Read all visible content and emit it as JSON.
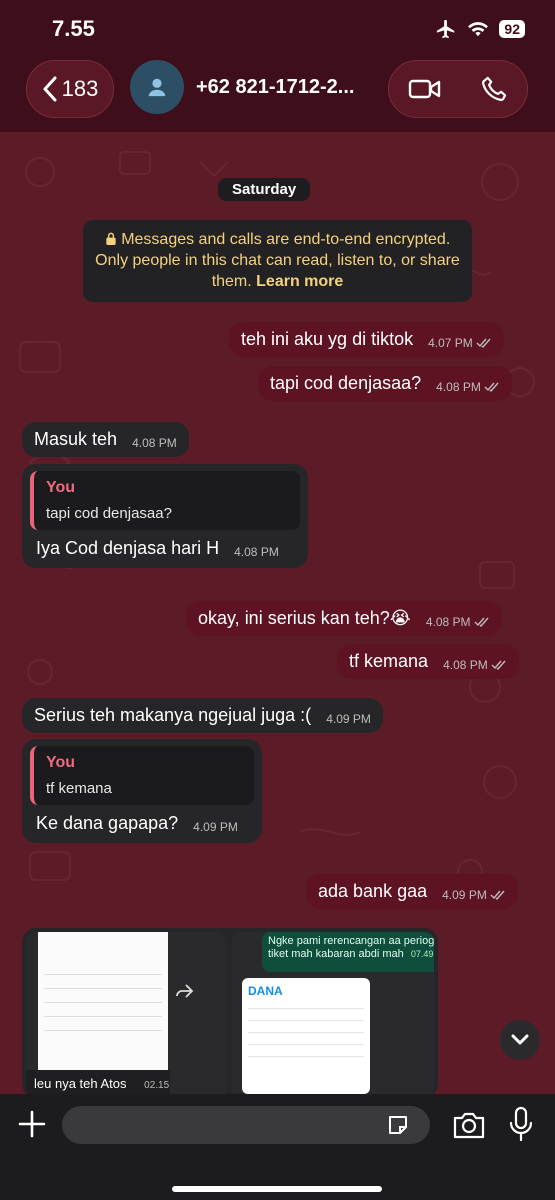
{
  "status_bar": {
    "time": "7.55",
    "battery": "92"
  },
  "header": {
    "back_count": "183",
    "contact": "+62 821-1712-2..."
  },
  "chat": {
    "date": "Saturday",
    "encryption_notice": "Messages and calls are end-to-end encrypted. Only people in this chat can read, listen to, or share them.",
    "learn_more": "Learn more",
    "messages": [
      {
        "text": "teh ini aku yg di tiktok",
        "time": "4.07 PM"
      },
      {
        "text": "tapi cod denjasaa?",
        "time": "4.08 PM"
      },
      {
        "text": "Masuk teh",
        "time": "4.08 PM"
      },
      {
        "quote_author": "You",
        "quote_text": "tapi cod denjasaa?",
        "text": "Iya Cod denjasa hari H",
        "time": "4.08 PM"
      },
      {
        "text": "okay, ini serius kan teh?😭",
        "time": "4.08 PM"
      },
      {
        "text": "tf kemana",
        "time": "4.08 PM"
      },
      {
        "text": "Serius teh makanya ngejual juga :(",
        "time": "4.09 PM"
      },
      {
        "quote_author": "You",
        "quote_text": "tf kemana",
        "text": "Ke dana gapapa?",
        "time": "4.09 PM"
      },
      {
        "text": "ada bank gaa",
        "time": "4.09 PM"
      }
    ],
    "album": {
      "left_caption": "leu nya teh Atos",
      "left_time": "02.15",
      "right_caption": "Ngke pami rerencangan aa periogi tiket mah kabaran abdi mah",
      "right_time": "07.49",
      "dana_brand": "DANA"
    }
  },
  "composer": {
    "placeholder": ""
  },
  "colors": {
    "accent": "#e8657c",
    "outgoing": "#5e1322",
    "incoming": "#262628"
  },
  "icons": [
    "airplane-icon",
    "wifi-icon",
    "back-chevron-icon",
    "avatar-person-icon",
    "video-call-icon",
    "phone-icon",
    "lock-icon",
    "double-check-icon",
    "forward-icon",
    "chevron-down-icon",
    "plus-icon",
    "sticker-icon",
    "camera-icon",
    "microphone-icon"
  ]
}
